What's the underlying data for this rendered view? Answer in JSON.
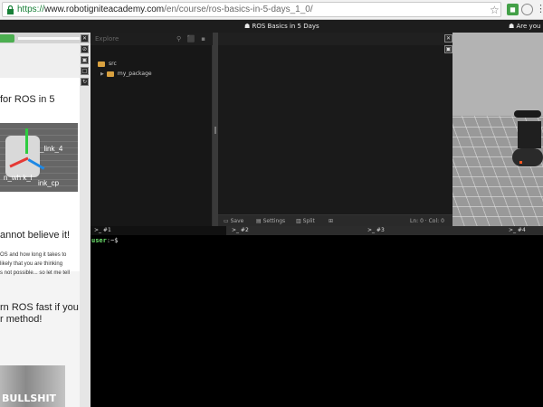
{
  "browser": {
    "url_scheme": "https://",
    "url_host": "www.robotigniteacademy.com",
    "url_path": "/en/course/ros-basics-in-5-days_1_0/",
    "star_icon": "star-icon",
    "menu_glyph": "⋮"
  },
  "topbar": {
    "title": "☗ ROS Basics in 5 Days",
    "right_text": "☗ Are you a"
  },
  "notebook": {
    "heading1": "for ROS in 5",
    "image_label1": "_link_4",
    "image_label2": "n_wh  k_l",
    "image_label3": "ink_cp",
    "heading2": "annot believe it!",
    "para_line1": "OS and how long it takes to",
    "para_line2": "likely that you are thinking",
    "para_line3": "s not possible... so let me tell",
    "heading3_line1": "rn ROS fast if you",
    "heading3_line2": "r method!",
    "meme_text": "BULLSHIT"
  },
  "explorer": {
    "title": "Explore",
    "tree": [
      {
        "label": "src"
      },
      {
        "label": "my_package"
      }
    ]
  },
  "editor": {
    "save_label": "Save",
    "settings_label": "Settings",
    "split_label": "Split",
    "cursor_position": "Ln: 0 · Col: 0"
  },
  "terminal": {
    "tabs": [
      {
        "label": ">_ #1"
      },
      {
        "label": ">_ #2"
      },
      {
        "label": ">_ #3"
      },
      {
        "label": ">_ #4"
      }
    ],
    "prompt_user": "user",
    "prompt_path": ":~$"
  },
  "colors": {
    "accent_green": "#4caf50",
    "folder": "#d9a140",
    "terminal_prompt": "#6ce06c"
  }
}
